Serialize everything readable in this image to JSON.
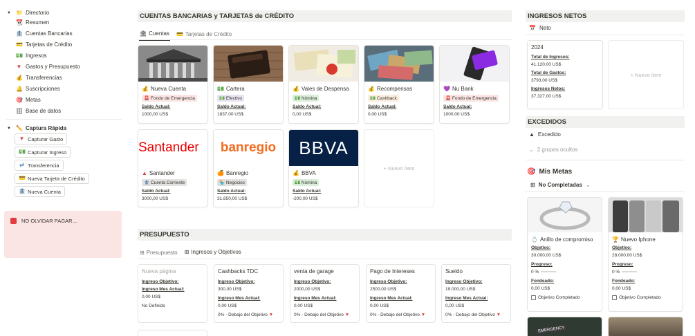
{
  "sidebar": {
    "directorio": "Directorio",
    "items": [
      "Resumen",
      "Cuentas Bancarias",
      "Tarjetas de Crédito",
      "Ingresos",
      "Gastos y Presupuesto",
      "Transferencias",
      "Suscripciones",
      "Metas",
      "Base de datos"
    ],
    "captura": "Captura Rápida",
    "quick": [
      "Capturar Gasto",
      "Capturar Ingreso",
      "Transferencia",
      "Nueva Tarjeta de Crédito",
      "Nueva Cuenta"
    ],
    "callout": "NO OLVIDAR PAGAR...."
  },
  "cuentas": {
    "title": "CUENTAS BANCARIAS y TARJETAS de CRÉDITO",
    "tabs": [
      "Cuentas",
      "Tarjetas de Crédito"
    ],
    "saldo_label": "Saldo Actual:",
    "cards": [
      {
        "name": "Nueva Cuenta",
        "tag": "Fondo de Emergencia",
        "saldo": "1000,00 US$"
      },
      {
        "name": "Cartera",
        "tag": "Efectivo",
        "saldo": "1837,00 US$"
      },
      {
        "name": "Vales de Despensa",
        "tag": "Nómina",
        "saldo": "0,00 US$"
      },
      {
        "name": "Recompensas",
        "tag": "Cashback",
        "saldo": "0,00 US$"
      },
      {
        "name": "Nu Bank",
        "tag": "Fondo de Emergencia",
        "saldo": "1000,00 US$"
      },
      {
        "name": "Santander",
        "tag": "Cuenta Corriente",
        "saldo": "3000,00 US$",
        "logo": "Santander"
      },
      {
        "name": "Banregio",
        "tag": "Negocios",
        "saldo": "31.850,00 US$",
        "logo": "banregio"
      },
      {
        "name": "BBVA",
        "tag": "Nómina",
        "saldo": "-200,00 US$",
        "logo": "BBVA"
      }
    ],
    "new_item": "+ Nuevo ítem"
  },
  "presupuesto": {
    "title": "PRESUPUESTO",
    "tabs": [
      "Presupuesto",
      "Ingresos y Objetivos"
    ],
    "obj_label": "Ingreso Objetivo:",
    "mes_label": "Ingreso Mes Actual:",
    "cards": [
      {
        "name": "Nueva página",
        "objetivo": "",
        "mes": "0,00 US$",
        "status": "No Definido",
        "placeholder": true
      },
      {
        "name": "Cashbacks TDC",
        "objetivo": "300,00 US$",
        "mes": "0,00 US$",
        "status": "0% - Debajo del Objetivo"
      },
      {
        "name": "venta de garage",
        "objetivo": "2000,00 US$",
        "mes": "0,00 US$",
        "status": "0% - Debajo del Objetivo"
      },
      {
        "name": "Pago de Intereses",
        "objetivo": "2500,00 US$",
        "mes": "0,00 US$",
        "status": "0% - Debajo del Objetivo"
      },
      {
        "name": "Sueldo",
        "objetivo": "19.000,00 US$",
        "mes": "0,00 US$",
        "status": "0% - Debajo del Objetivo"
      }
    ]
  },
  "ingresos_netos": {
    "title": "INGRESOS NETOS",
    "view": "Neto",
    "year": "2024",
    "total_ingresos_label": "Total de Ingresos:",
    "total_ingresos": "41.120,00 US$",
    "total_gastos_label": "Total de Gastos:",
    "total_gastos": "3793,00 US$",
    "netos_label": "Ingresos Netos:",
    "netos": "37.327,00 US$",
    "new_item": "+ Nuevo ítem"
  },
  "excedidos": {
    "title": "EXCEDIDOS",
    "group": "Excedido",
    "hidden": "2 grupos ocultos"
  },
  "metas": {
    "title": "Mis Metas",
    "view": "No Completadas",
    "obj_label": "Objetivo:",
    "prog_label": "Progreso:",
    "fond_label": "Fondeado:",
    "completed_label": "Objetivo Completado",
    "cards": [
      {
        "name": "Anillo de compromiso",
        "objetivo": "30.000,00 US$",
        "progreso": "0 %",
        "fondeado": "0,00 US$"
      },
      {
        "name": "Nuevo Iphone",
        "objetivo": "28.000,00 US$",
        "progreso": "0 %",
        "fondeado": "0,00 US$"
      }
    ],
    "bottom_card_text": "EMERGENCY"
  },
  "colors": {
    "red_tag": "#fbe4e4",
    "purple_tag": "#eae4f2",
    "green_tag": "#dbeddb",
    "orange_tag": "#fbecdd",
    "gray_tag": "#e3e2e0",
    "santander": "#ec0000",
    "banregio": "#f36d21",
    "bbva": "#072146"
  }
}
